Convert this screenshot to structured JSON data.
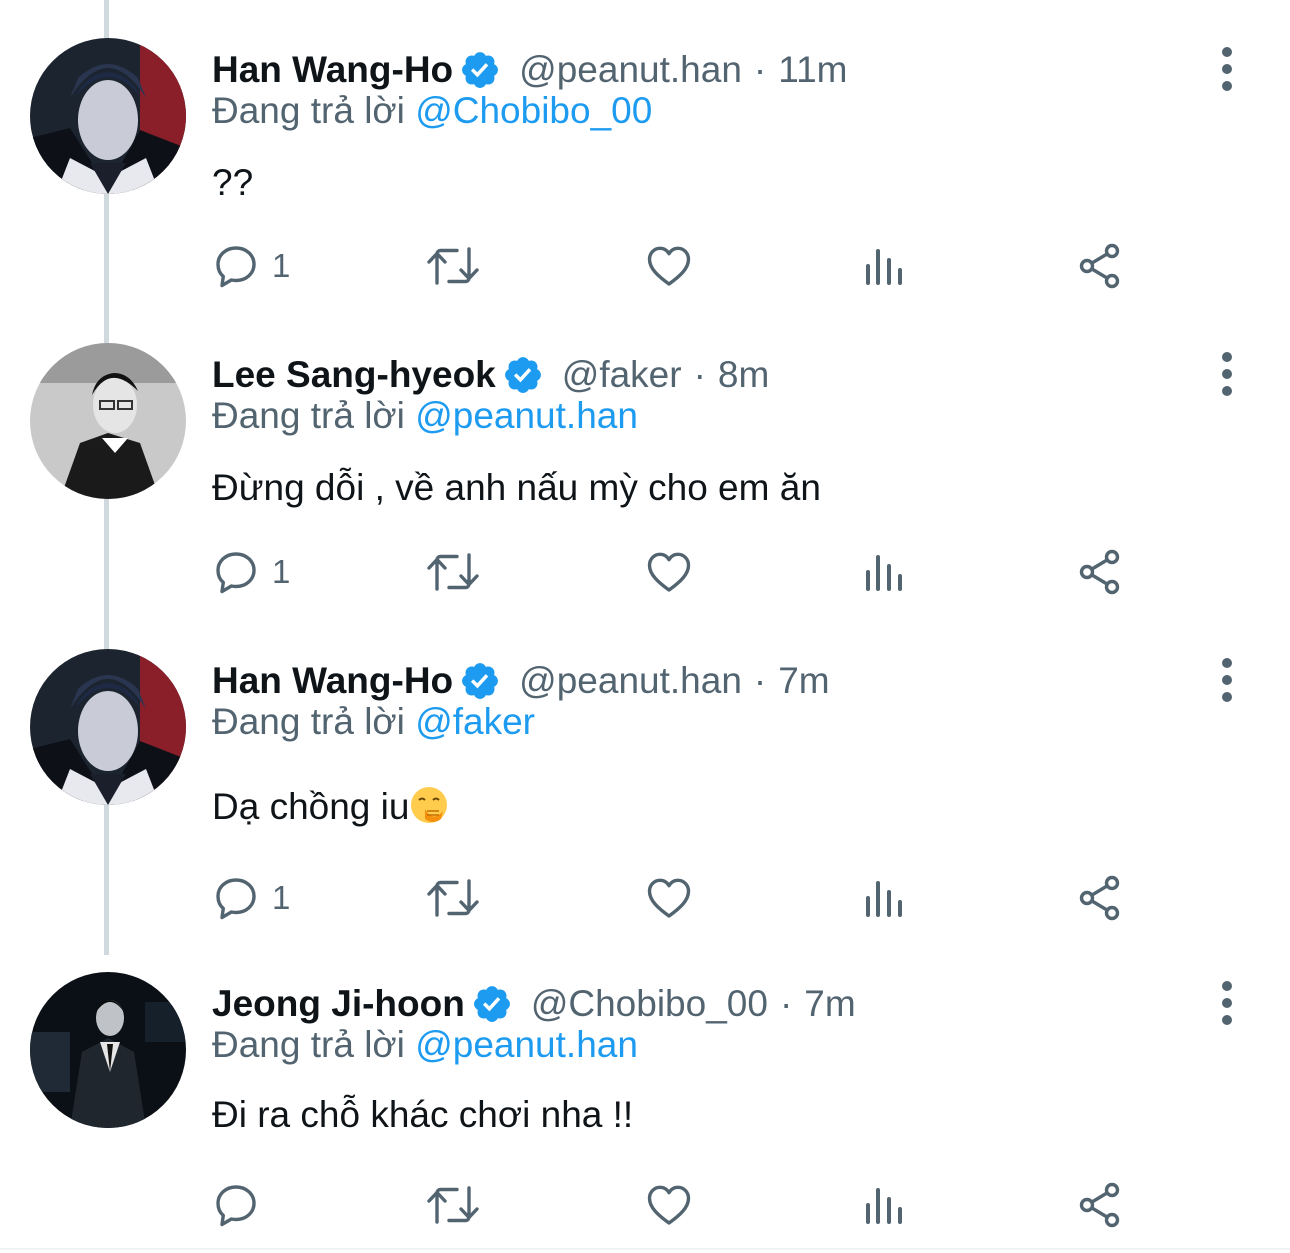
{
  "colors": {
    "text_primary": "#0f1419",
    "text_secondary": "#536471",
    "accent": "#1d9bf0",
    "thread_line": "#cfd9de"
  },
  "icons": {
    "verified": "verified-badge-icon",
    "more": "more-vertical-icon",
    "reply": "reply-icon",
    "retweet": "retweet-icon",
    "like": "heart-icon",
    "views": "analytics-icon",
    "share": "share-icon",
    "emoji": "hand-over-mouth-emoji-icon"
  },
  "tweets": [
    {
      "display_name": "Han Wang-Ho",
      "handle": "@peanut.han",
      "separator": "·",
      "time": "11m",
      "reply_prefix": "Đang trả lời",
      "reply_to": "@Chobibo_00",
      "text": "??",
      "reply_count": "1",
      "avatar": "avatar-han-wang-ho"
    },
    {
      "display_name": "Lee Sang-hyeok",
      "handle": "@faker",
      "separator": "·",
      "time": "8m",
      "reply_prefix": "Đang trả lời",
      "reply_to": "@peanut.han",
      "text": "Đừng dỗi , về anh nấu mỳ cho em ăn",
      "reply_count": "1",
      "avatar": "avatar-lee-sang-hyeok"
    },
    {
      "display_name": "Han Wang-Ho",
      "handle": "@peanut.han",
      "separator": "·",
      "time": "7m",
      "reply_prefix": "Đang trả lời",
      "reply_to": "@faker",
      "text": "Dạ chồng iu",
      "reply_count": "1",
      "avatar": "avatar-han-wang-ho"
    },
    {
      "display_name": "Jeong Ji-hoon",
      "handle": "@Chobibo_00",
      "separator": "·",
      "time": "7m",
      "reply_prefix": "Đang trả lời",
      "reply_to": "@peanut.han",
      "text": "Đi ra chỗ khác chơi nha !!",
      "reply_count": "",
      "avatar": "avatar-jeong-ji-hoon"
    }
  ]
}
